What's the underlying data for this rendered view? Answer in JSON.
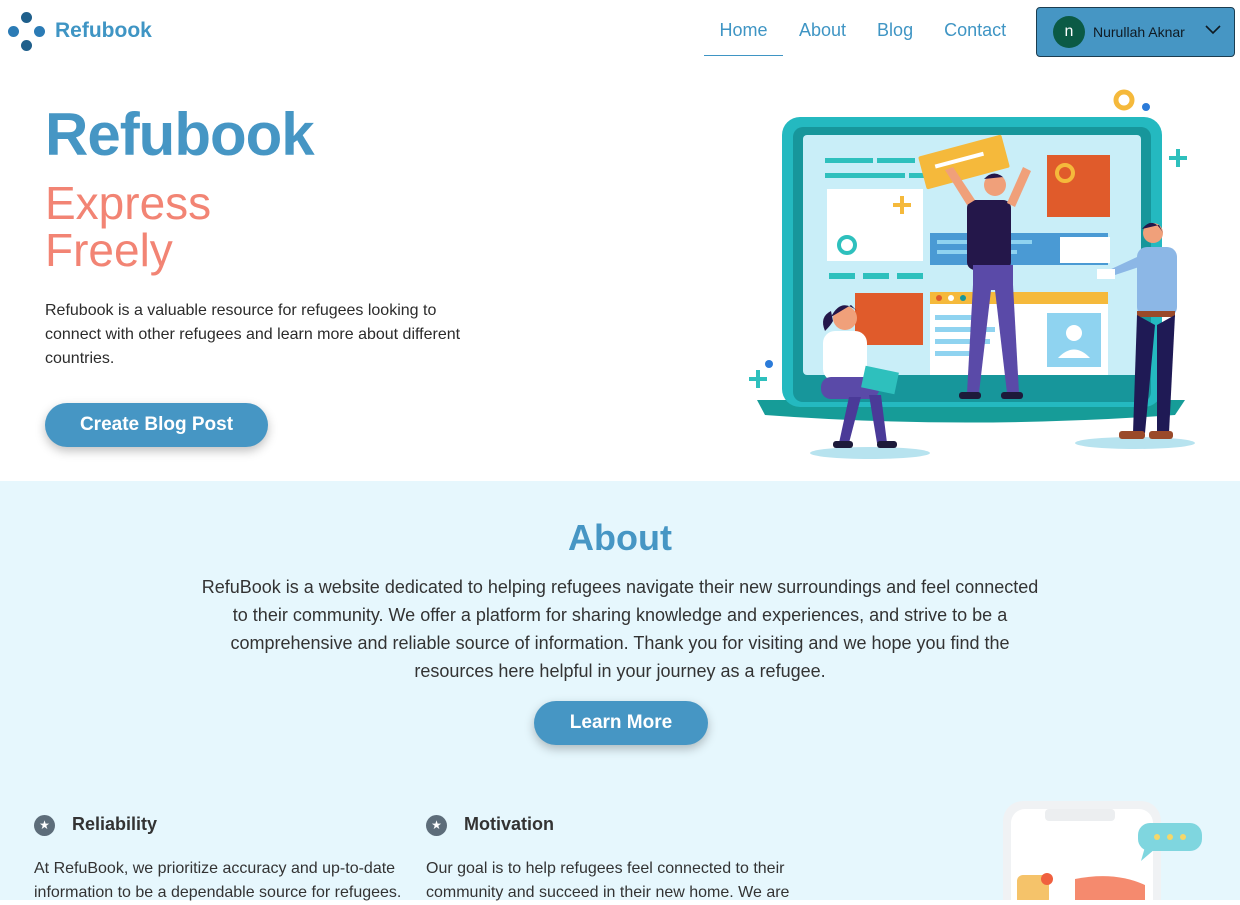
{
  "navbar": {
    "brand": "Refubook",
    "links": [
      "Home",
      "About",
      "Blog",
      "Contact"
    ],
    "user": {
      "initial": "n",
      "name": "Nurullah Aknar"
    }
  },
  "hero": {
    "title": "Refubook",
    "subtitle_line1": "Express",
    "subtitle_line2": "Freely",
    "description": "Refubook is a valuable resource for refugees looking to connect with other refugees and learn more about different countries.",
    "cta": "Create Blog Post"
  },
  "about": {
    "title": "About",
    "text": "RefuBook is a website dedicated to helping refugees navigate their new surroundings and feel connected to their community. We offer a platform for sharing knowledge and experiences, and strive to be a comprehensive and reliable source of information. Thank you for visiting and we hope you find the resources here helpful in your journey as a refugee.",
    "cta": "Learn More",
    "features": [
      {
        "title": "Reliability",
        "icon": "star-icon",
        "text": "At RefuBook, we prioritize accuracy and up-to-date information to be a dependable source for refugees."
      },
      {
        "title": "Motivation",
        "icon": "star-icon",
        "text": "Our goal is to help refugees feel connected to their community and succeed in their new home. We are"
      }
    ]
  },
  "colors": {
    "brand_blue": "#4696c4",
    "coral": "#f28474",
    "about_bg": "#e6f7fd",
    "avatar_green": "#0b5a45"
  }
}
